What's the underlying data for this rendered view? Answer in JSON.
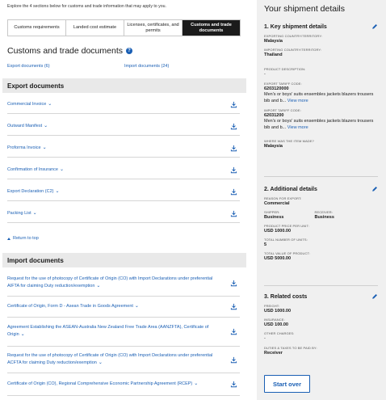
{
  "intro": "Explore the 4 sections below for customs and trade information that may apply to you.",
  "tabs": [
    {
      "label": "Customs requirements"
    },
    {
      "label": "Landed cost estimate"
    },
    {
      "label": "Licenses, certificates, and permits"
    },
    {
      "label": "Customs and trade documents"
    }
  ],
  "heading": "Customs and trade documents",
  "export_link": "Export documents (6)",
  "import_link": "Import documents (24)",
  "export_section": "Export documents",
  "export_docs": [
    {
      "name": "Commercial Invoice"
    },
    {
      "name": "Outward Manifest"
    },
    {
      "name": "Proforma Invoice"
    },
    {
      "name": "Confirmation of Insurance"
    },
    {
      "name": "Export Declaration (C2)"
    },
    {
      "name": "Packing List"
    }
  ],
  "back_to_top": "Return to top",
  "import_section": "Import documents",
  "import_docs": [
    {
      "name": "Request for the use of photocopy of Certificate of Origin (CO) with Import Declarations under preferential AIFTA for claiming Duty reduction/exemption"
    },
    {
      "name": "Certificate of Origin, Form D - Asean Trade in Goods Agreement"
    },
    {
      "name": "Agreement Establishing the ASEAN-Australia New Zealand Free Trade Area (AANZFTA), Certificate of Origin"
    },
    {
      "name": "Request for the use of photocopy of Certificate of Origin (CO) with Import Declarations under preferential ACFTA for claiming Duty reduction/exemption"
    },
    {
      "name": "Certificate of Origin (CO), Regional Comprehensive Economic Partnership Agreement (RCEP)"
    }
  ],
  "summary": {
    "title": "Your shipment details",
    "s1": {
      "title": "1. Key shipment details",
      "exporting_label": "EXPORTING COUNTRY/TERRITORY:",
      "exporting_value": "Malaysia",
      "importing_label": "IMPORTING COUNTRY/TERRITORY:",
      "importing_value": "Thailand",
      "desc_label": "PRODUCT DESCRIPTION:",
      "desc_value": "-",
      "export_code_label": "EXPORT TARIFF CODE:",
      "export_code": "6203120000",
      "export_code_desc": "Men's or boys' suits ensembles jackets blazers trousers bib and b...",
      "import_code_label": "IMPORT TARIFF CODE:",
      "import_code": "62031200",
      "import_code_desc": "Men's or boys' suits ensembles jackets blazers trousers bib and b...",
      "view_more": "View more",
      "made_label": "WHERE WAS THE ITEM MADE?",
      "made_value": "Malaysia"
    },
    "s2": {
      "title": "2. Additional details",
      "reason_label": "REASON FOR EXPORT:",
      "reason_value": "Commercial",
      "shipper_label": "SHIPPER:",
      "shipper_value": "Business",
      "receiver_label": "RECEIVER:",
      "receiver_value": "Business",
      "price_label": "PRODUCT PRICE PER UNIT:",
      "price_value": "USD 1000.00",
      "units_label": "TOTAL NUMBER OF UNITS:",
      "units_value": "5",
      "total_label": "TOTAL VALUE OF PRODUCT:",
      "total_value": "USD 5000.00"
    },
    "s3": {
      "title": "3. Related costs",
      "freight_label": "FREIGHT:",
      "freight_value": "USD 1000.00",
      "insurance_label": "INSURANCE:",
      "insurance_value": "USD 100.00",
      "other_label": "OTHER CHARGES:",
      "other_value": "-",
      "duties_label": "DUTIES & TAXES TO BE PAID BY:",
      "duties_value": "Receiver"
    },
    "start_over": "Start over"
  }
}
